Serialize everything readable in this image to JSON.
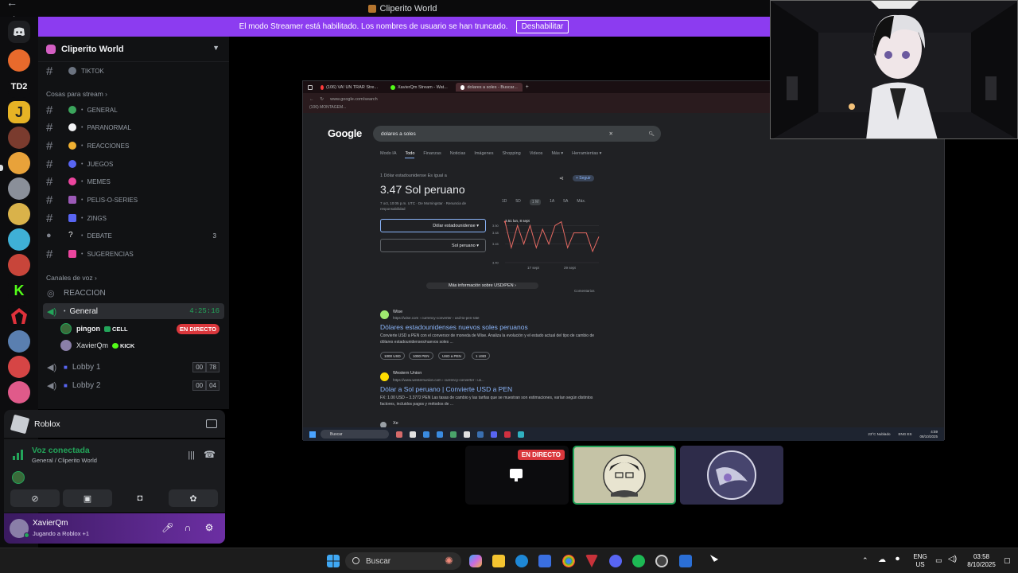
{
  "window": {
    "title": "Cliperito World",
    "nav_glyphs": "← →"
  },
  "banner": {
    "text": "El modo Streamer está habilitado. Los nombres de usuario se han truncado.",
    "button": "Deshabilitar"
  },
  "server_rail": {
    "top_label": "TD2",
    "k_label": "K"
  },
  "server": {
    "name": "Cliperito World"
  },
  "channels": {
    "top_item": "TIKTOK",
    "category_stream": "Cosas para stream",
    "items": [
      {
        "name": "GENERAL",
        "emoji_color": "#3ba55c"
      },
      {
        "name": "PARANORMAL",
        "emoji_color": "#f2f3f5"
      },
      {
        "name": "REACCIONES",
        "emoji_color": "#f0b132"
      },
      {
        "name": "JUEGOS",
        "emoji_color": "#5865f2"
      },
      {
        "name": "MEMES",
        "emoji_color": "#eb459e"
      },
      {
        "name": "PELIS-O-SERIES",
        "emoji_color": "#9b59b6"
      },
      {
        "name": "ZINGS",
        "emoji_color": "#5865f2"
      },
      {
        "name": "DEBATE",
        "emoji_color": "#f2f3f5",
        "count": "3"
      },
      {
        "name": "SUGERENCIAS",
        "emoji_color": "#eb459e"
      }
    ],
    "category_voice": "Canales de voz",
    "reaccion": "REACCION",
    "voice": {
      "general": {
        "name": "General",
        "timer": "4:25:16"
      },
      "members": [
        {
          "name": "pingon",
          "tag": "CELL",
          "live": "EN DIRECTO"
        },
        {
          "name": "XavierQm",
          "tag": "KICK"
        }
      ],
      "lobby1": {
        "name": "Lobby 1",
        "a": "00",
        "b": "78"
      },
      "lobby2": {
        "name": "Lobby 2",
        "a": "00",
        "b": "04"
      }
    }
  },
  "activity": {
    "name": "Roblox"
  },
  "voice_panel": {
    "status": "Voz conectada",
    "location": "General / Cliperito World"
  },
  "user": {
    "name": "XavierQm",
    "status": "Jugando a Roblox +1"
  },
  "stream": {
    "tabs": [
      "(106) VA! UN TRAR Stre...",
      "XavierQm Stream - Wat...",
      "dolares a soles - Buscar..."
    ],
    "url": "www.google.com/search",
    "bookmark": "(106) MONTAGEM...",
    "google": {
      "logo": "Google",
      "query": "dolares a soles",
      "tabs": [
        "Modo IA",
        "Todo",
        "Finanzas",
        "Noticias",
        "Imágenes",
        "Shopping",
        "Videos",
        "Más ▾",
        "Herramientas ▾"
      ],
      "converter_intro": "1 Dólar estadounidense Es igual a",
      "rate": "3.47 Sol peruano",
      "rate_meta": "7 oct, 10:05 p.m. UTC · De Morningstar · Renuncia de responsabilidad",
      "follow": "+ Seguir",
      "from_currency": "Dólar estadounidense",
      "to_currency": "Sol peruano",
      "ranges": [
        "1D",
        "5D",
        "1 M",
        "1A",
        "5A",
        "Máx."
      ],
      "chart_ticks": [
        "3.50",
        "3.48",
        "3.45",
        "3.40"
      ],
      "chart_point_label": "3.51  lun, 8 sept",
      "chart_xticks": [
        "17 sept",
        "29 sept"
      ],
      "more_info": "Más información sobre USD/PEN  ›",
      "feedback": "Comentarios",
      "results": [
        {
          "site": "Wise",
          "url": "https://wise.com › currency-converter › usd-to-pen-rate",
          "title": "Dólares estadounidenses nuevos soles peruanos",
          "snippet": "Convierte USD a PEN con el conversor de moneda de Wise. Analiza la evolución y el estado actual del tipo de cambio de dólares estadounidenses/nuevos soles ...",
          "chips": [
            "1000 USD",
            "1000 PEN",
            "USD a PEN",
            "1 USD"
          ]
        },
        {
          "site": "Western Union",
          "url": "https://www.westernunion.com › currency-converter › us...",
          "title": "Dólar a Sol peruano | Convierte USD a PEN",
          "snippet": "FX: 1.00 USD – 3.3772 PEN Las tasas de cambio y las tarifas que se muestran son estimaciones, varían según distintos factores, incluidos pagos y métodos de ..."
        }
      ],
      "third_site": "Xe"
    },
    "taskbar": {
      "search": "Buscar",
      "weather": "23°C Nublado",
      "lang": "ENG ES",
      "time": "4:59",
      "date": "08/10/2025"
    }
  },
  "chart_data": {
    "type": "line",
    "title": "",
    "xlabel": "",
    "ylabel": "",
    "x": [
      "8 sept",
      "10 sept",
      "12 sept",
      "14 sept",
      "15 sept",
      "17 sept",
      "19 sept",
      "21 sept",
      "23 sept",
      "25 sept",
      "27 sept",
      "29 sept",
      "1 oct",
      "3 oct",
      "5 oct",
      "7 oct"
    ],
    "series": [
      {
        "values": [
          3.51,
          3.44,
          3.5,
          3.45,
          3.5,
          3.44,
          3.49,
          3.45,
          3.5,
          3.51,
          3.44,
          3.48,
          3.48,
          3.48,
          3.43,
          3.47
        ]
      }
    ],
    "ylim": [
      3.4,
      3.52
    ],
    "line_color": "#e46962"
  },
  "tiles": {
    "live": "EN DIRECTO"
  },
  "taskbar": {
    "search": "Buscar",
    "lang_top": "ENG",
    "lang_bottom": "US",
    "time": "03:58",
    "date": "8/10/2025"
  }
}
